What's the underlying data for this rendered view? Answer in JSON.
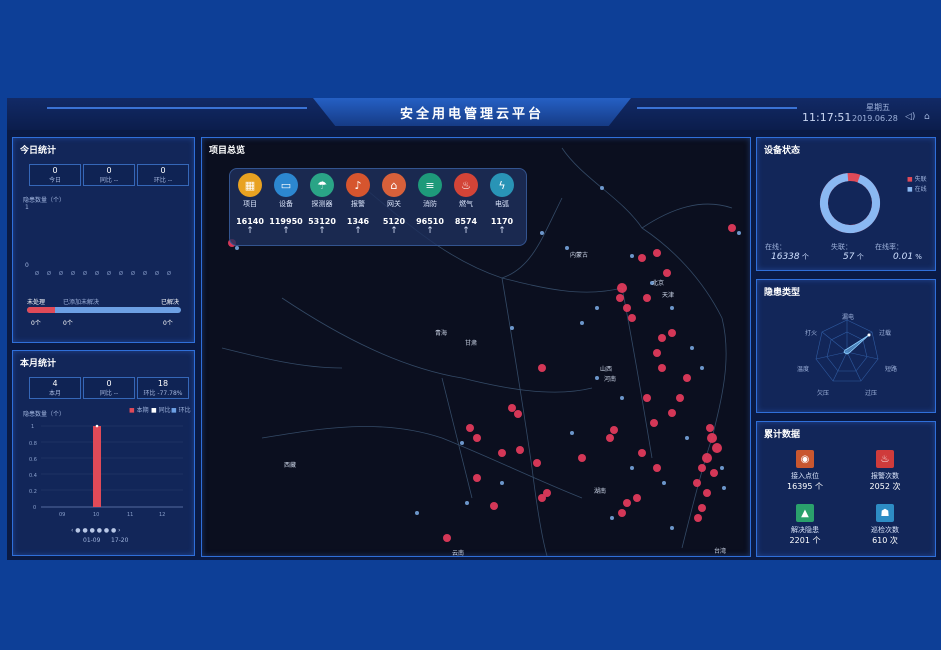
{
  "header": {
    "title": "安全用电管理云平台",
    "time": "11:17:51",
    "weekday": "星期五",
    "date": "2019.06.28",
    "sound_icon": "speaker-icon",
    "home_icon": "home-icon"
  },
  "today": {
    "title": "今日统计",
    "stats": [
      {
        "value": "0",
        "label": "今日"
      },
      {
        "value": "0",
        "label": "同比 --"
      },
      {
        "value": "0",
        "label": "环比 --"
      }
    ],
    "chart_title": "隐患数量（个）",
    "y_top": "1",
    "y_zero": "0",
    "status_unprocessed": "未处理",
    "status_processing": "已添加未解决",
    "status_resolved": "已解决",
    "count_left": "0个",
    "count_mid": "0个",
    "count_right": "0个"
  },
  "month": {
    "title": "本月统计",
    "stats": [
      {
        "value": "4",
        "label": "本月"
      },
      {
        "value": "0",
        "label": "同比 --"
      },
      {
        "value": "18",
        "label": "环比 -77.78%"
      }
    ],
    "chart_title": "隐患数量（个）",
    "legend": [
      "本期",
      "同比",
      "环比"
    ],
    "pager": "‹ ● ● ● ● ● ● ›",
    "range_start": "01-09",
    "range_end": "17-20"
  },
  "overview": {
    "title": "项目总览",
    "items": [
      {
        "label": "项目",
        "value": "16140",
        "arrow": "↑",
        "color": "#e8a221",
        "icon": "▦"
      },
      {
        "label": "设备",
        "value": "119950",
        "arrow": "↑",
        "color": "#2c87d0",
        "icon": "▭"
      },
      {
        "label": "探测器",
        "value": "53120",
        "arrow": "↑",
        "color": "#2aa486",
        "icon": "☂"
      },
      {
        "label": "报警",
        "value": "1346",
        "arrow": "↑",
        "color": "#d6552e",
        "icon": "♪"
      },
      {
        "label": "网关",
        "value": "5120",
        "arrow": "↑",
        "color": "#d7603a",
        "icon": "⌂"
      },
      {
        "label": "消防",
        "value": "96510",
        "arrow": "↑",
        "color": "#1e9a7a",
        "icon": "≡"
      },
      {
        "label": "燃气",
        "value": "8574",
        "arrow": "↑",
        "color": "#d34437",
        "icon": "♨"
      },
      {
        "label": "电弧",
        "value": "1170",
        "arrow": "↑",
        "color": "#2994b6",
        "icon": "ϟ"
      }
    ]
  },
  "map_labels": [
    "内蒙古",
    "天津",
    "北京",
    "青海",
    "甘肃",
    "山西",
    "河南",
    "西藏",
    "湖南",
    "台湾",
    "云南"
  ],
  "device_status": {
    "title": "设备状态",
    "legend": [
      "失联",
      "在线"
    ],
    "online_label": "在线：",
    "online_value": "16338",
    "online_unit": "个",
    "lost_label": "失联：",
    "lost_value": "57",
    "lost_unit": "个",
    "rate_label": "在线率：",
    "rate_value": "0.01",
    "rate_unit": "%",
    "online_fraction": 0.93
  },
  "hazard": {
    "title": "隐患类型",
    "axes": [
      "漏电",
      "过载",
      "短路",
      "过压",
      "欠压",
      "温度",
      "打火"
    ]
  },
  "cumulative": {
    "title": "累计数据",
    "items": [
      {
        "label": "接入点位",
        "value": "16395",
        "unit": "个",
        "color": "#c9572f",
        "icon": "◉"
      },
      {
        "label": "报警次数",
        "value": "2052",
        "unit": "次",
        "color": "#cf3b3b",
        "icon": "♨"
      },
      {
        "label": "解决隐患",
        "value": "2201",
        "unit": "个",
        "color": "#2aa16c",
        "icon": "▲"
      },
      {
        "label": "巡检次数",
        "value": "610",
        "unit": "次",
        "color": "#2d8cc4",
        "icon": "☗"
      }
    ]
  }
}
